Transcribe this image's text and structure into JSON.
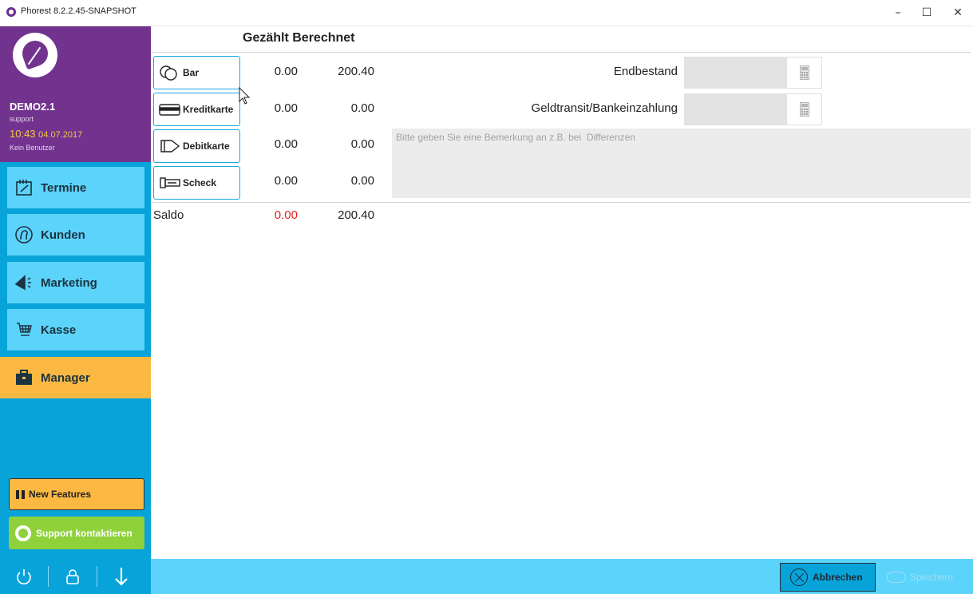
{
  "window": {
    "title": "Phorest 8.2.2.45-SNAPSHOT",
    "min": "–",
    "max": "☐",
    "close": "✕"
  },
  "profile": {
    "user": "DEMO2.1",
    "role": "support",
    "time": "10:43",
    "date": "04.07.2017",
    "status": "Kein Benutzer"
  },
  "nav": {
    "termine": "Termine",
    "kunden": "Kunden",
    "marketing": "Marketing",
    "kasse": "Kasse",
    "manager": "Manager"
  },
  "sidebar_buttons": {
    "new_features": "New Features",
    "support": "Support kontaktieren"
  },
  "header": {
    "title": "Gezählt Berechnet"
  },
  "payments": [
    {
      "label": "Bar",
      "counted": "0.00",
      "calculated": "200.40",
      "icon": "coins-icon"
    },
    {
      "label": "Kreditkarte",
      "counted": "0.00",
      "calculated": "0.00",
      "icon": "credit-card-icon"
    },
    {
      "label": "Debitkarte",
      "counted": "0.00",
      "calculated": "0.00",
      "icon": "debit-card-icon"
    },
    {
      "label": "Scheck",
      "counted": "0.00",
      "calculated": "0.00",
      "icon": "cheque-icon"
    }
  ],
  "saldo": {
    "label": "Saldo",
    "counted": "0.00",
    "calculated": "200.40"
  },
  "fields": {
    "endbestand_label": "Endbestand",
    "endbestand_value": "",
    "geldtransit_label": "Geldtransit/Bankeinzahlung",
    "geldtransit_value": "",
    "remark_placeholder": "Bitte geben Sie eine Bemerkung an z.B. bei  Differenzen",
    "remark_value": ""
  },
  "footer": {
    "cancel": "Abbrechen",
    "save": "Speichern"
  },
  "colors": {
    "profile_bg": "#72338f",
    "sidebar_bg": "#08a3d9",
    "nav_bg": "#5cd3fa",
    "active_nav": "#fbb843",
    "support_bg": "#8fd13b",
    "negative": "#e02222"
  }
}
